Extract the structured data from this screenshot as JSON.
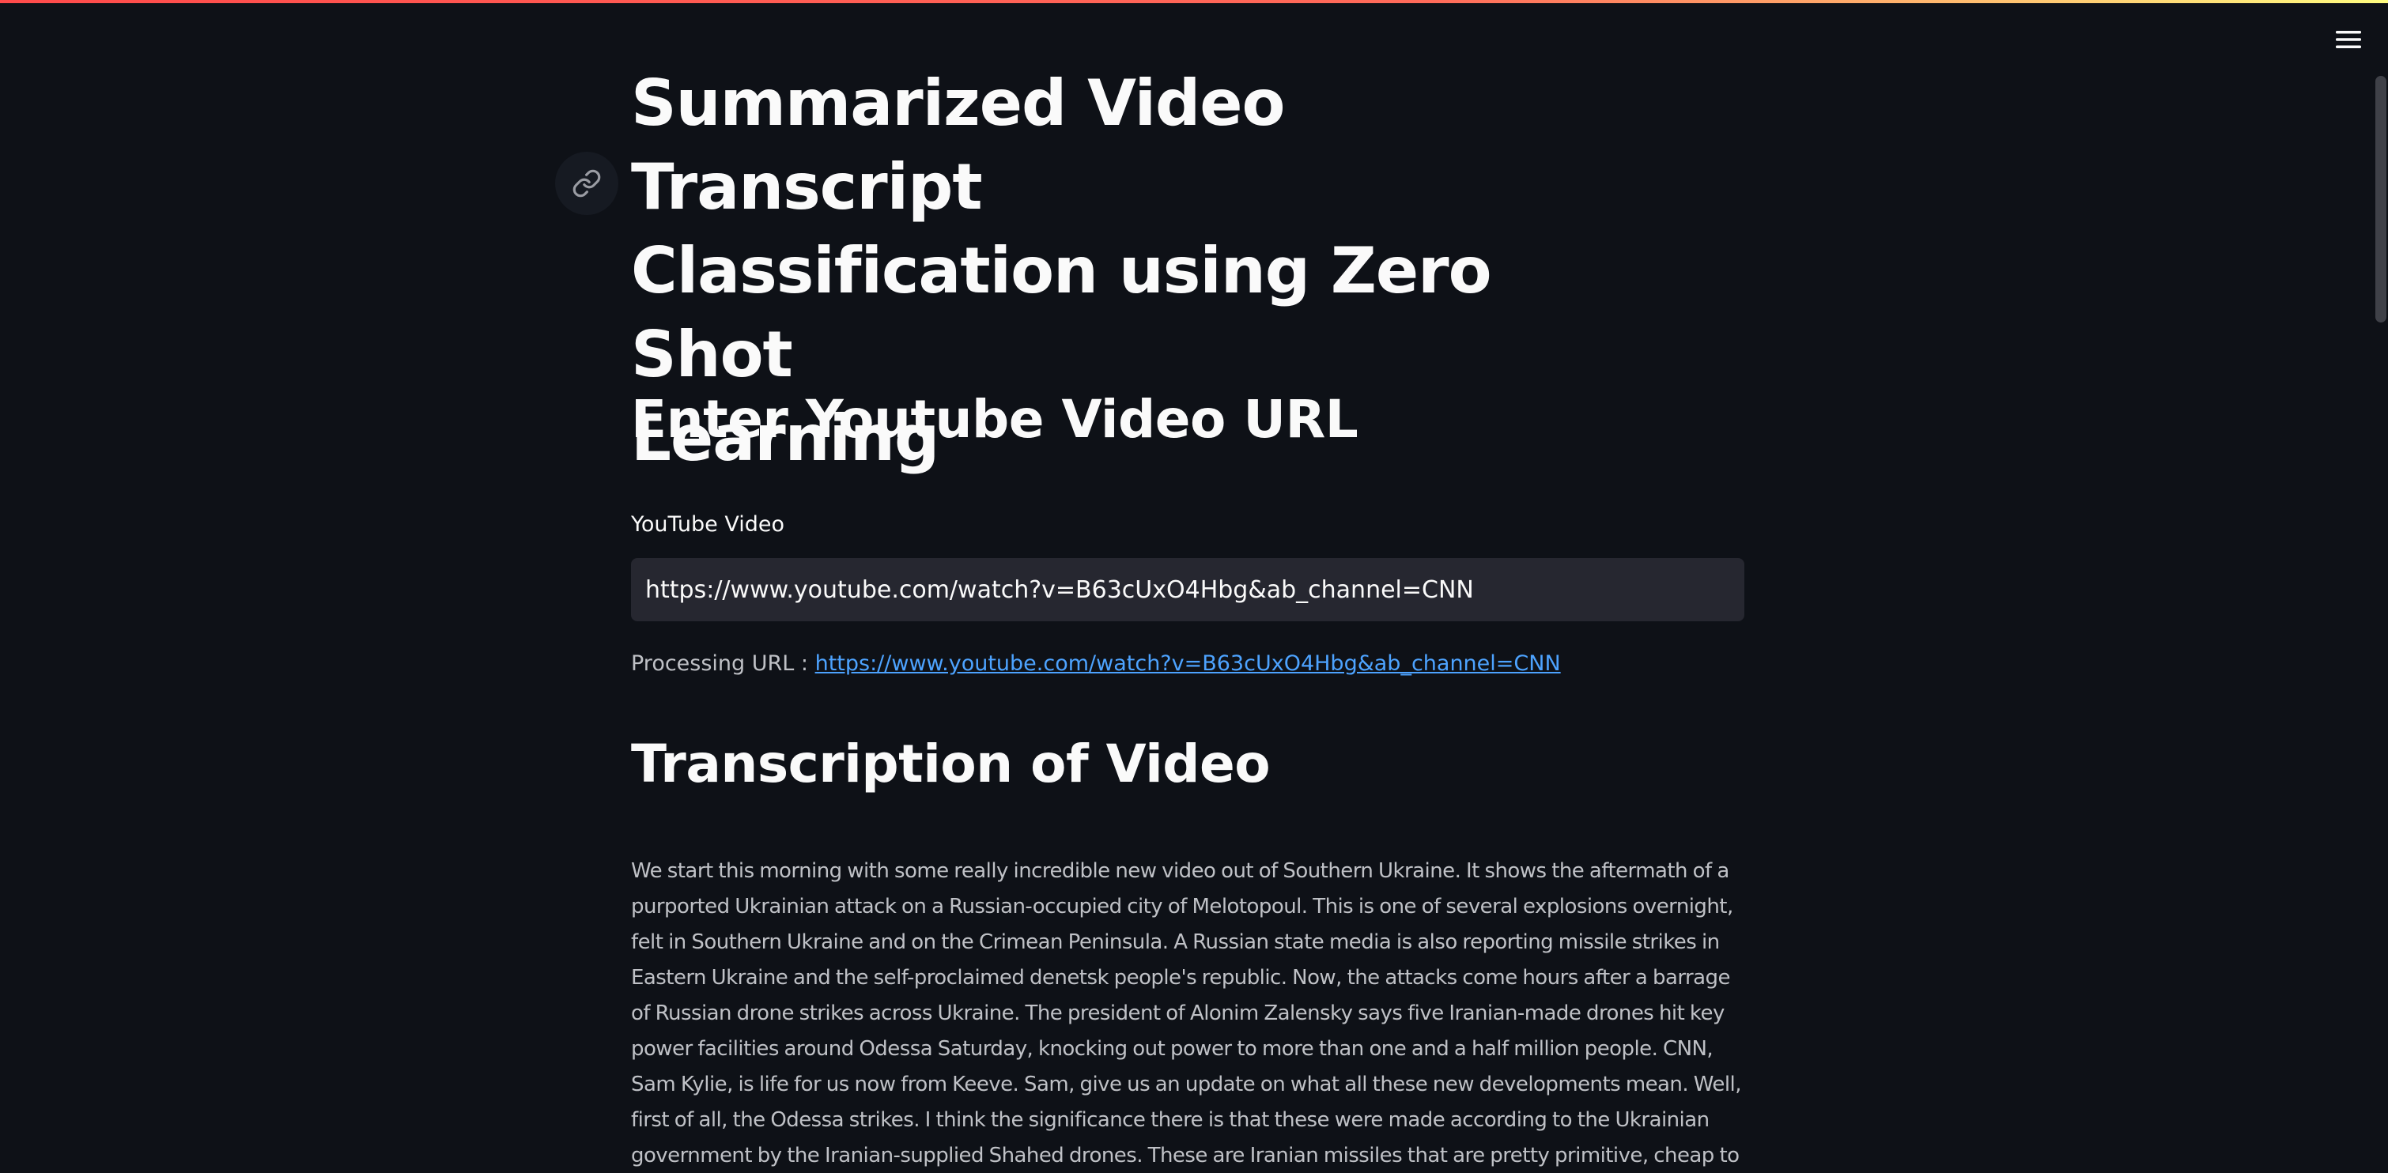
{
  "header": {
    "menu_icon": "hamburger-menu-icon",
    "decoration_colors": [
      "#ff4b4b",
      "#fffd80"
    ]
  },
  "main": {
    "title_lines": [
      "Summarized Video Transcript",
      "Classification using Zero Shot",
      "Learning"
    ],
    "anchor_icon": "link-icon",
    "enter_heading": "Enter Youtube Video URL",
    "input_label": "YouTube Video",
    "input_value": "https://www.youtube.com/watch?v=B63cUxO4Hbg&ab_channel=CNN",
    "processing_label": "Processing URL : ",
    "processing_link": "https://www.youtube.com/watch?v=B63cUxO4Hbg&ab_channel=CNN",
    "transcription_heading": "Transcription of Video",
    "transcript_text": "We start this morning with some really incredible new video out of Southern Ukraine. It shows the aftermath of a purported Ukrainian attack on a Russian-occupied city of Melotopoul. This is one of several explosions overnight, felt in Southern Ukraine and on the Crimean Peninsula. A Russian state media is also reporting missile strikes in Eastern Ukraine and the self-proclaimed denetsk people's republic. Now, the attacks come hours after a barrage of Russian drone strikes across Ukraine. The president of Alonim Zalensky says five Iranian-made drones hit key power facilities around Odessa Saturday, knocking out power to more than one and a half million people. CNN, Sam Kylie, is life for us now from Keeve. Sam, give us an update on what all these new developments mean. Well, first of all, the Odessa strikes. I think the significance there is that these were made according to the Ukrainian government by the Iranian-supplied Shahed drones. These are Iranian missiles that are pretty primitive, cheap to make, but they had been an assumption by the,"
  }
}
